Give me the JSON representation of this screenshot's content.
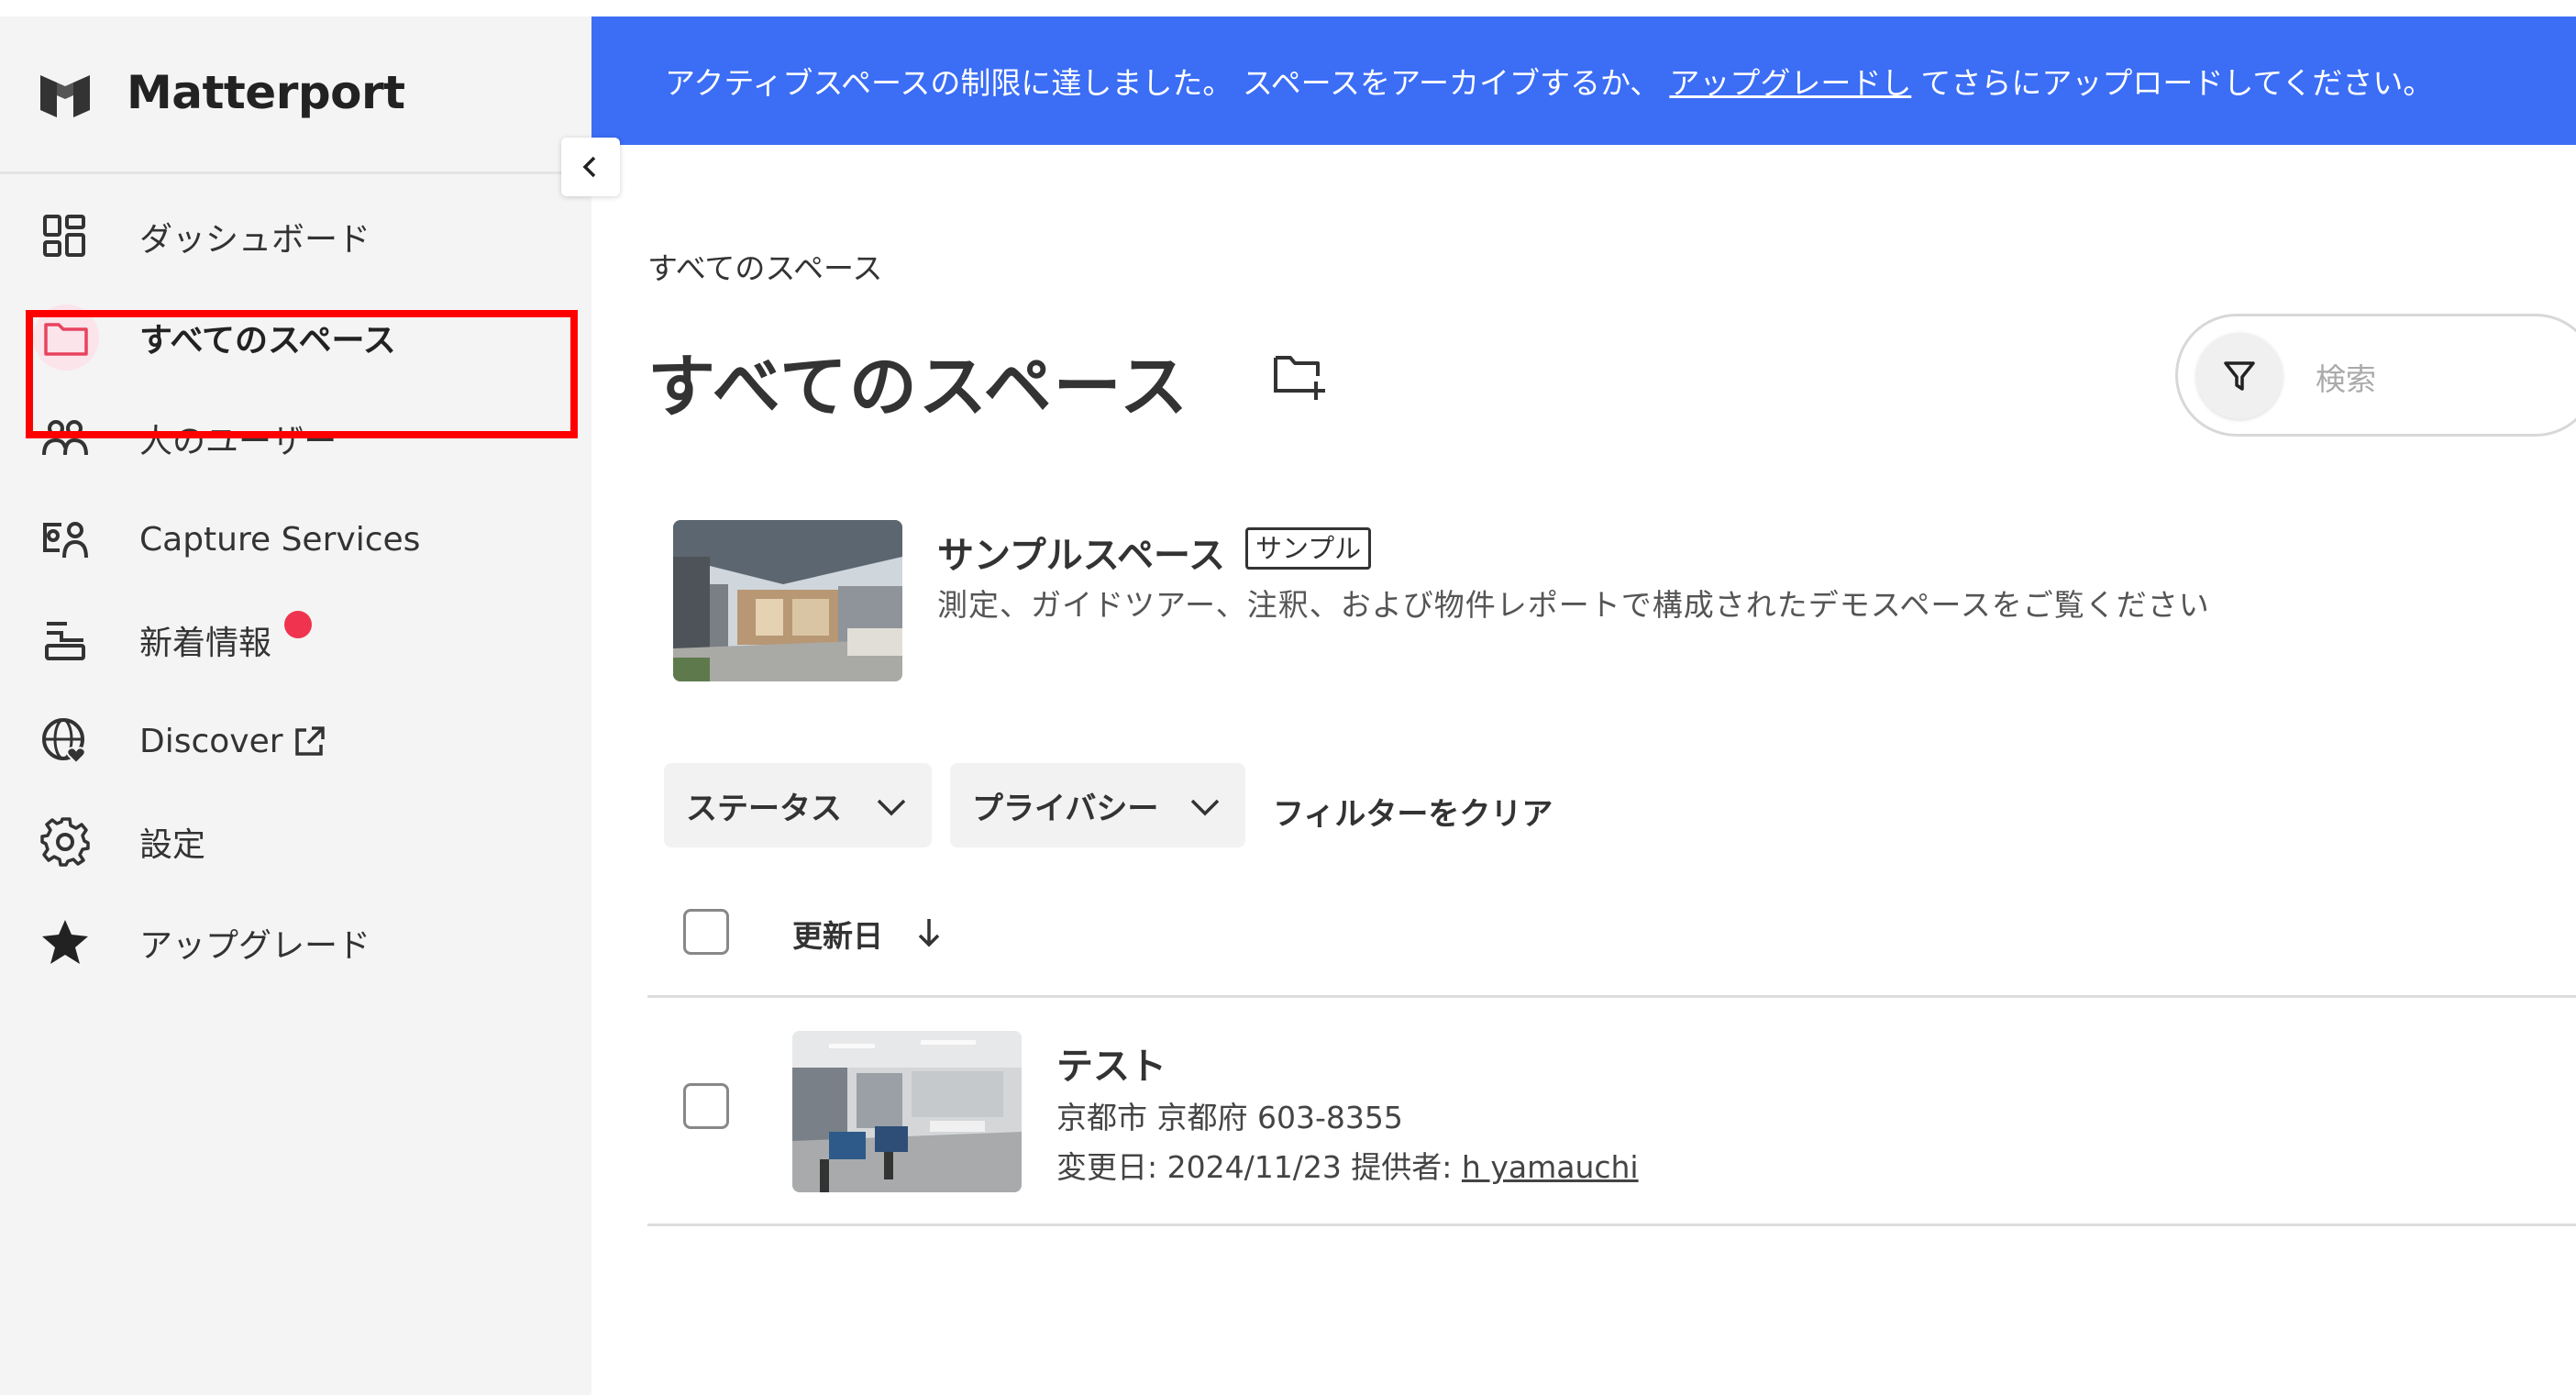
{
  "brand": {
    "name": "Matterport"
  },
  "sidebar": {
    "items": [
      {
        "label": "ダッシュボード",
        "icon": "dashboard-icon"
      },
      {
        "label": "すべてのスペース",
        "icon": "folder-icon",
        "active": true
      },
      {
        "label": "人のユーザー",
        "icon": "users-icon"
      },
      {
        "label": "Capture Services",
        "icon": "capture-services-icon"
      },
      {
        "label": "新着情報",
        "icon": "whats-new-icon",
        "badge": "red-dot"
      },
      {
        "label": "Discover",
        "icon": "globe-heart-icon",
        "external": true
      },
      {
        "label": "設定",
        "icon": "gear-icon"
      },
      {
        "label": "アップグレード",
        "icon": "star-icon"
      }
    ]
  },
  "banner": {
    "text_before": "アクティブスペースの制限に達しました。 スペースをアーカイブするか、",
    "link": "アップグレードし",
    "text_after": "てさらにアップロードしてください。"
  },
  "main": {
    "breadcrumb": "すべてのスペース",
    "title": "すべてのスペース",
    "search_placeholder": "検索"
  },
  "sample": {
    "title": "サンプルスペース",
    "badge": "サンプル",
    "description": "測定、ガイドツアー、注釈、および物件レポートで構成されたデモスペースをご覧ください"
  },
  "filters": {
    "status": "ステータス",
    "privacy": "プライバシー",
    "clear": "フィルターをクリア"
  },
  "table": {
    "sort_column": "更新日",
    "rows": [
      {
        "title": "テスト",
        "address": "京都市 京都府 603-8355",
        "modified_label": "変更日: 2024/11/23 提供者: ",
        "author": "h yamauchi"
      }
    ]
  },
  "colors": {
    "banner": "#3b6df5",
    "highlight": "#ff0000",
    "accent": "#f0334f"
  }
}
